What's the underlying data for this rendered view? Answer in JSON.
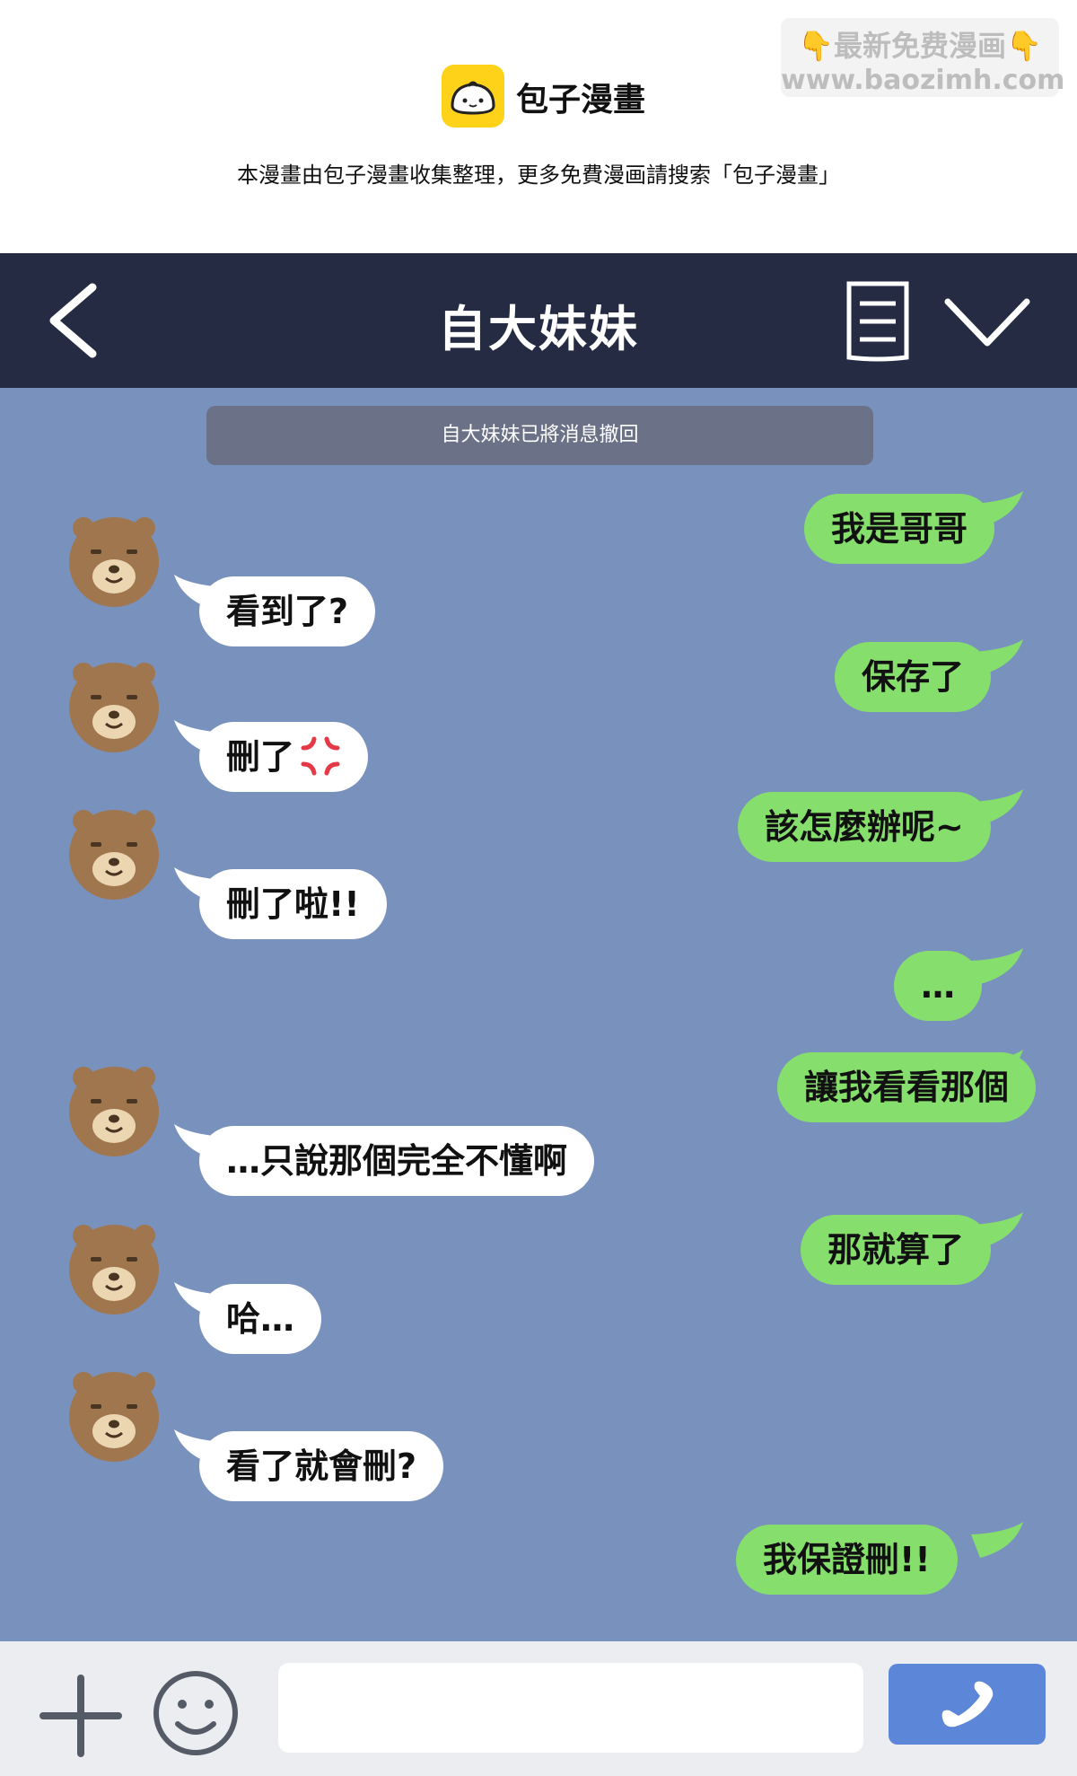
{
  "banner": {
    "brand_name": "包子漫畫",
    "note": "本漫畫由包子漫畫收集整理，更多免費漫画請搜索「包子漫畫」",
    "watermark_line1": "👇最新免费漫画👇",
    "watermark_line2": "www.baozimh.com"
  },
  "header": {
    "title": "自大妹妹",
    "icons": [
      "back-icon",
      "notes-icon",
      "chevron-down-icon"
    ]
  },
  "chat": {
    "system_notice": "自大妹妹已將消息撤回",
    "messages": [
      {
        "sender": "me",
        "text": "我是哥哥"
      },
      {
        "sender": "sister",
        "text": "看到了?"
      },
      {
        "sender": "me",
        "text": "保存了"
      },
      {
        "sender": "sister",
        "text": "刪了",
        "icon": "angry-icon"
      },
      {
        "sender": "me",
        "text": "該怎麼辦呢~"
      },
      {
        "sender": "sister",
        "text": "刪了啦!!"
      },
      {
        "sender": "me",
        "text": "…"
      },
      {
        "sender": "me",
        "text": "讓我看看那個"
      },
      {
        "sender": "sister",
        "text": "…只說那個完全不懂啊"
      },
      {
        "sender": "me",
        "text": "那就算了"
      },
      {
        "sender": "sister",
        "text": "哈…"
      },
      {
        "sender": "sister",
        "text": "看了就會刪?"
      },
      {
        "sender": "me",
        "text": "我保證刪!!"
      }
    ]
  },
  "input_bar": {
    "value": "",
    "placeholder": "",
    "icons": [
      "plus-icon",
      "emoji-icon",
      "send-icon"
    ]
  },
  "colors": {
    "header_bg": "#252b42",
    "chat_bg": "#7891bd",
    "my_bubble": "#86de6c",
    "their_bubble": "#ffffff",
    "send_button": "#5c86d8",
    "brand_yellow": "#ffd21a"
  }
}
